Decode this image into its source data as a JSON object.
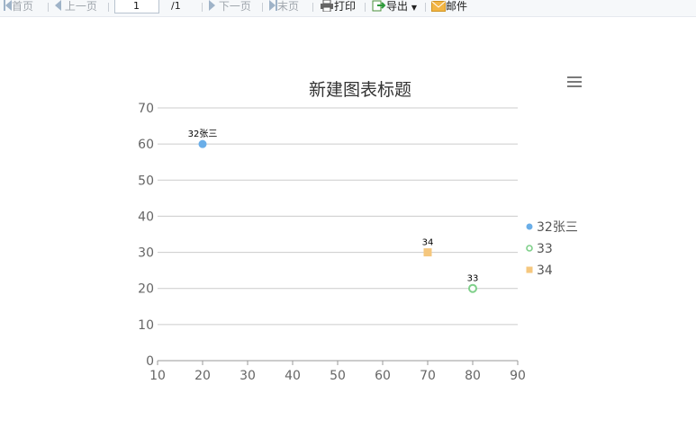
{
  "toolbar": {
    "first_label": "首页",
    "prev_label": "上一页",
    "page_value": "1",
    "page_total": "/1",
    "next_label": "下一页",
    "last_label": "末页",
    "print_label": "打印",
    "export_label": "导出",
    "mail_label": "邮件"
  },
  "colors": {
    "series_32": "#6aaee8",
    "series_33": "#7fd08a",
    "series_34": "#f5c77e",
    "grid": "#cccccc",
    "axis_text": "#666666",
    "title": "#333333"
  },
  "chart_data": {
    "type": "scatter",
    "title": "新建图表标题",
    "xlabel": "",
    "ylabel": "",
    "xlim": [
      10,
      90
    ],
    "ylim": [
      0,
      70
    ],
    "x_ticks": [
      10,
      20,
      30,
      40,
      50,
      60,
      70,
      80,
      90
    ],
    "y_ticks": [
      0,
      10,
      20,
      30,
      40,
      50,
      60,
      70
    ],
    "grid": true,
    "legend_position": "right",
    "series": [
      {
        "name": "32张三",
        "marker": "filled-circle",
        "points": [
          {
            "x": 20,
            "y": 60,
            "label": "32张三"
          }
        ]
      },
      {
        "name": "33",
        "marker": "hollow-circle",
        "points": [
          {
            "x": 80,
            "y": 20,
            "label": "33"
          }
        ]
      },
      {
        "name": "34",
        "marker": "square",
        "points": [
          {
            "x": 70,
            "y": 30,
            "label": "34"
          }
        ]
      }
    ]
  }
}
